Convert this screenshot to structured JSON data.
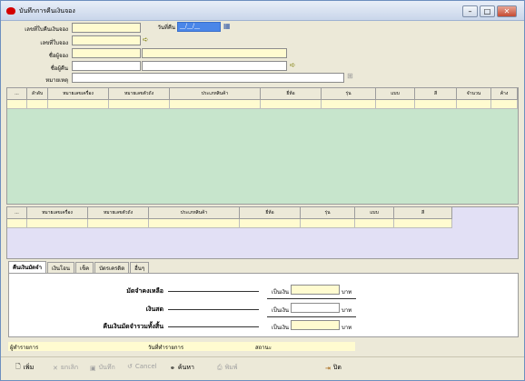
{
  "window": {
    "title": "บันทึกการคืนเงินจอง",
    "minimize": "–",
    "maximize": "□",
    "close": "✕"
  },
  "form": {
    "receipt_label": "เลขที่ใบคืนเงินจอง",
    "date_label": "วันที่คืน",
    "date_value": "__/__/__",
    "booking_label": "เลขที่ใบจอง",
    "booker_label": "ชื่อผู้จอง",
    "refund_to_label": "ชื่อผู้คืน",
    "remark_label": "หมายเหตุ"
  },
  "grid1": {
    "headers": [
      "...",
      "ลำดับ",
      "หมายเลขเครื่อง",
      "หมายเลขตัวถัง",
      "ประเภทสินค้า",
      "ยี่ห้อ",
      "รุ่น",
      "แบบ",
      "สี",
      "จำนวน",
      "ค้าง"
    ]
  },
  "grid2": {
    "headers": [
      "...",
      "หมายเลขเครื่อง",
      "หมายเลขตัวถัง",
      "ประเภทสินค้า",
      "ยี่ห้อ",
      "รุ่น",
      "แบบ",
      "สี"
    ]
  },
  "tabs": [
    "คืนเงินมัดจำ",
    "เงินโอน",
    "เช็ค",
    "บัตรเครดิต",
    "อื่นๆ"
  ],
  "summary": {
    "deposit_balance_label": "มัดจำคงเหลือ",
    "cash_label": "เงินสด",
    "total_refund_label": "คืนเงินมัดจำรวมทั้งสิ้น",
    "amount_label": "เป็นเงิน",
    "currency": "บาท"
  },
  "status": {
    "recorder_label": "ผู้ทำรายการ",
    "record_date_label": "วันที่ทำรายการ",
    "state_label": "สถานะ"
  },
  "toolbar": {
    "add": "เพิ่ม",
    "cancel_doc": "ยกเลิก",
    "save": "บันทึก",
    "cancel": "Cancel",
    "search": "ค้นหา",
    "print": "พิมพ์",
    "close": "ปิด"
  }
}
